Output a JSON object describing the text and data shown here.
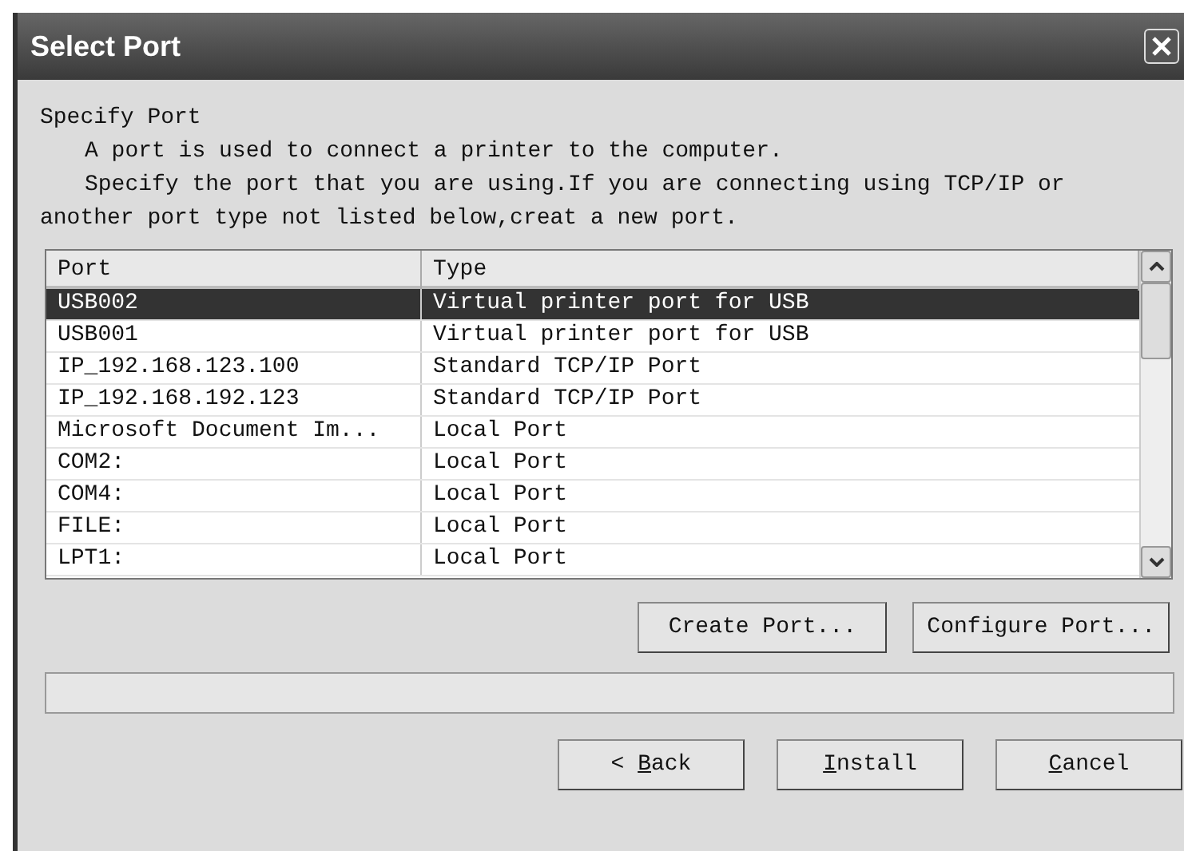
{
  "window": {
    "title": "Select Port"
  },
  "intro": {
    "heading": "Specify Port",
    "line_1": "A port is used to connect a printer to the computer.",
    "line_2": "Specify the port that you are using.If you are connecting using TCP/IP or another port type not listed below,creat a new port."
  },
  "table": {
    "columns": [
      "Port",
      "Type"
    ],
    "rows": [
      {
        "port": "USB002",
        "type": "Virtual printer port for USB",
        "selected": true
      },
      {
        "port": "USB001",
        "type": "Virtual printer port for USB",
        "selected": false
      },
      {
        "port": "IP_192.168.123.100",
        "type": "Standard TCP/IP Port",
        "selected": false
      },
      {
        "port": "IP_192.168.192.123",
        "type": "Standard TCP/IP Port",
        "selected": false
      },
      {
        "port": "Microsoft Document Im...",
        "type": "Local Port",
        "selected": false
      },
      {
        "port": "COM2:",
        "type": "Local Port",
        "selected": false
      },
      {
        "port": "COM4:",
        "type": "Local Port",
        "selected": false
      },
      {
        "port": "FILE:",
        "type": "Local Port",
        "selected": false
      },
      {
        "port": "LPT1:",
        "type": "Local Port",
        "selected": false
      }
    ]
  },
  "port_buttons": [
    "Create Port...",
    "Configure Port..."
  ],
  "progress": {
    "level": 0
  },
  "buttons": [
    {
      "prefix": "< ",
      "key": "B",
      "rest": "ack"
    },
    {
      "key": "I",
      "rest": "nstall"
    },
    {
      "key": "C",
      "rest": "ancel"
    }
  ]
}
